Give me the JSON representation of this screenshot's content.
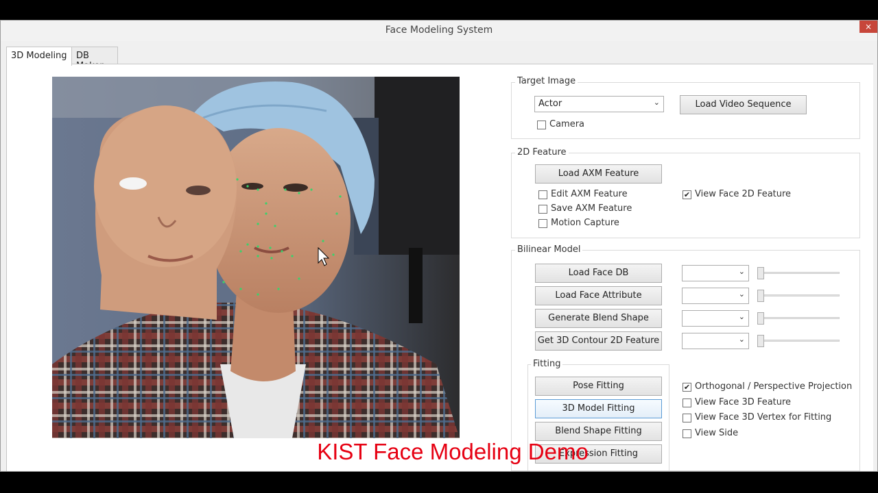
{
  "window": {
    "title": "Face Modeling System",
    "close_label": "×"
  },
  "tabs": [
    {
      "label": "3D Modeling",
      "active": true
    },
    {
      "label": "DB Maker",
      "active": false
    }
  ],
  "target_image": {
    "group_label": "Target Image",
    "source_select": "Actor",
    "load_video_button": "Load Video Sequence",
    "camera_checkbox": {
      "label": "Camera",
      "checked": false
    }
  },
  "feature_2d": {
    "group_label": "2D Feature",
    "load_axm_button": "Load AXM Feature",
    "checkboxes": [
      {
        "label": "Edit AXM Feature",
        "checked": false
      },
      {
        "label": "Save AXM Feature",
        "checked": false
      },
      {
        "label": "Motion Capture",
        "checked": false
      },
      {
        "label": "View Face 2D Feature",
        "checked": true
      }
    ]
  },
  "bilinear_model": {
    "group_label": "Bilinear Model",
    "rows": [
      {
        "button": "Load Face DB",
        "select": "",
        "slider": 0
      },
      {
        "button": "Load Face Attribute",
        "select": "",
        "slider": 0
      },
      {
        "button": "Generate Blend Shape",
        "select": "",
        "slider": 0
      },
      {
        "button": "Get 3D Contour 2D Feature",
        "select": "",
        "slider": 0
      }
    ]
  },
  "fitting": {
    "group_label": "Fitting",
    "buttons": [
      "Pose Fitting",
      "3D Model Fitting",
      "Blend Shape Fitting",
      "Expression Fitting"
    ],
    "checkboxes": [
      {
        "label": "Orthogonal / Perspective Projection",
        "checked": true
      },
      {
        "label": "View Face 3D Feature",
        "checked": false
      },
      {
        "label": "View Face 3D Vertex for Fitting",
        "checked": false
      },
      {
        "label": "View Side",
        "checked": false
      }
    ]
  },
  "caption": "KIST Face Modeling Demo",
  "icons": {
    "close": "close-icon",
    "dropdown": "chevron-down-icon",
    "check": "checkmark-icon",
    "cursor": "mouse-pointer-icon"
  },
  "colors": {
    "caption": "#e60012",
    "close": "#c7463a",
    "focus": "#5a9bd5"
  }
}
